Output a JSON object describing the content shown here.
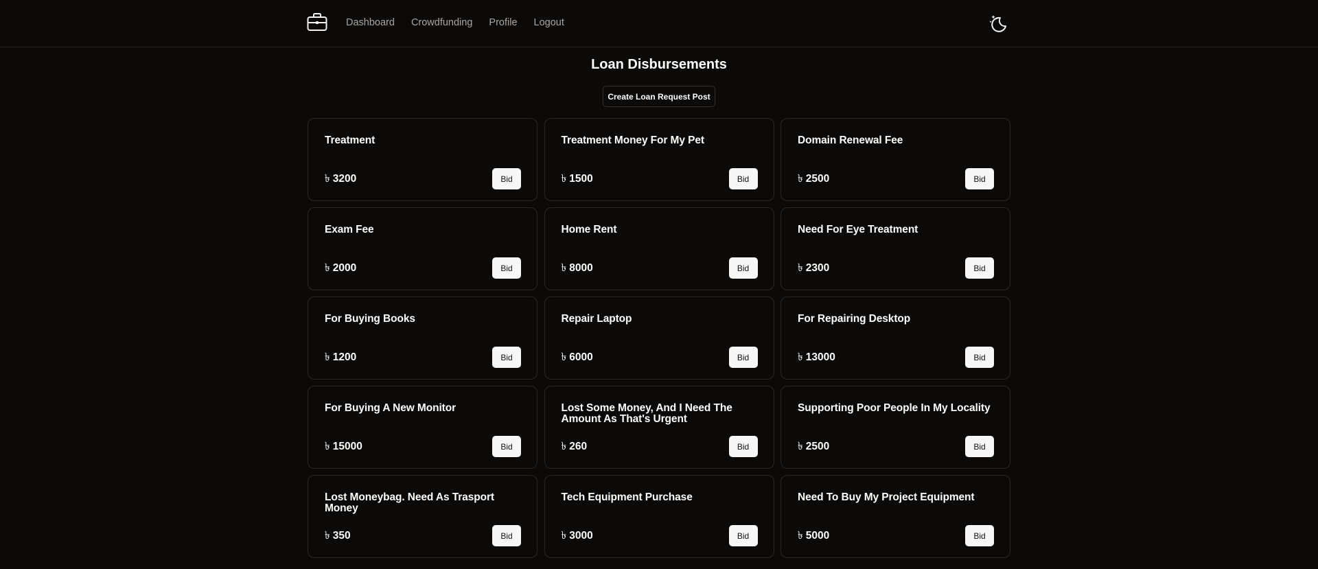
{
  "header": {
    "brand_icon": "briefcase-icon",
    "nav": [
      {
        "label": "Dashboard"
      },
      {
        "label": "Crowdfunding"
      },
      {
        "label": "Profile"
      },
      {
        "label": "Logout"
      }
    ],
    "theme_icon": "moon-stars-icon"
  },
  "main": {
    "title": "Loan Disbursements",
    "create_button": "Create Loan Request Post",
    "currency_symbol": "৳",
    "bid_label": "Bid",
    "cards": [
      {
        "title": "Treatment",
        "amount": "3200"
      },
      {
        "title": "Treatment Money For My Pet",
        "amount": "1500"
      },
      {
        "title": "Domain Renewal Fee",
        "amount": "2500"
      },
      {
        "title": "Exam Fee",
        "amount": "2000"
      },
      {
        "title": "Home Rent",
        "amount": "8000"
      },
      {
        "title": "Need For Eye Treatment",
        "amount": "2300"
      },
      {
        "title": "For Buying Books",
        "amount": "1200"
      },
      {
        "title": "Repair Laptop",
        "amount": "6000"
      },
      {
        "title": "For Repairing Desktop",
        "amount": "13000"
      },
      {
        "title": "For Buying A New Monitor",
        "amount": "15000"
      },
      {
        "title": "Lost Some Money, And I Need The Amount As That's Urgent",
        "amount": "260"
      },
      {
        "title": "Supporting Poor People In My Locality",
        "amount": "2500"
      },
      {
        "title": "Lost Moneybag. Need As Trasport Money",
        "amount": "350"
      },
      {
        "title": "Tech Equipment Purchase",
        "amount": "3000"
      },
      {
        "title": "Need To Buy My Project Equipment",
        "amount": "5000"
      }
    ]
  }
}
